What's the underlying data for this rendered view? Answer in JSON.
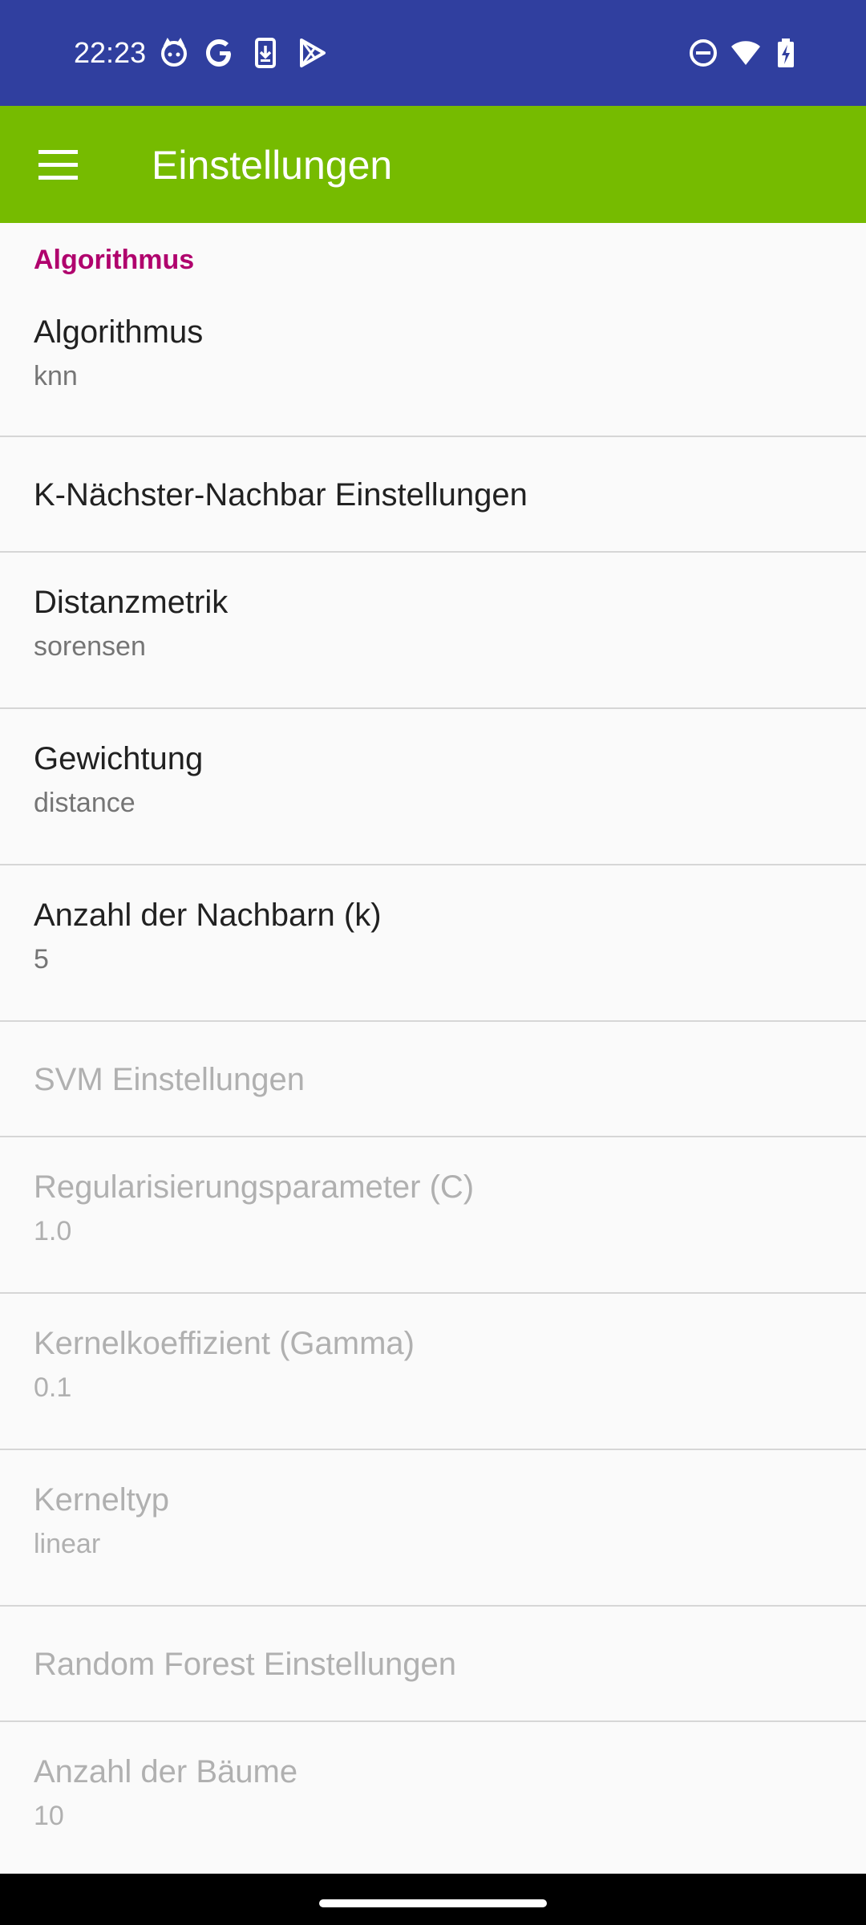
{
  "status_bar": {
    "time": "22:23",
    "left_icons": [
      "cat-face-icon",
      "google-g-icon",
      "download-icon",
      "play-store-icon"
    ],
    "right_icons": [
      "do-not-disturb-icon",
      "wifi-icon",
      "battery-charging-icon"
    ]
  },
  "app_bar": {
    "title": "Einstellungen",
    "menu_icon": "hamburger-menu-icon",
    "color": "#76bb00"
  },
  "category": {
    "title": "Algorithmus",
    "color": "#b0006d"
  },
  "prefs": [
    {
      "title": "Algorithmus",
      "summary": "knn",
      "enabled": true
    },
    {
      "title": "K-Nächster-Nachbar Einstellungen",
      "enabled": true
    },
    {
      "title": "Distanzmetrik",
      "summary": "sorensen",
      "enabled": true
    },
    {
      "title": "Gewichtung",
      "summary": "distance",
      "enabled": true
    },
    {
      "title": "Anzahl der Nachbarn (k)",
      "summary": "5",
      "enabled": true
    },
    {
      "title": "SVM Einstellungen",
      "enabled": false
    },
    {
      "title": "Regularisierungsparameter (C)",
      "summary": "1.0",
      "enabled": false
    },
    {
      "title": "Kernelkoeffizient (Gamma)",
      "summary": "0.1",
      "enabled": false
    },
    {
      "title": "Kerneltyp",
      "summary": "linear",
      "enabled": false
    },
    {
      "title": "Random Forest Einstellungen",
      "enabled": false
    },
    {
      "title": "Anzahl der Bäume",
      "summary": "10",
      "enabled": false
    }
  ]
}
